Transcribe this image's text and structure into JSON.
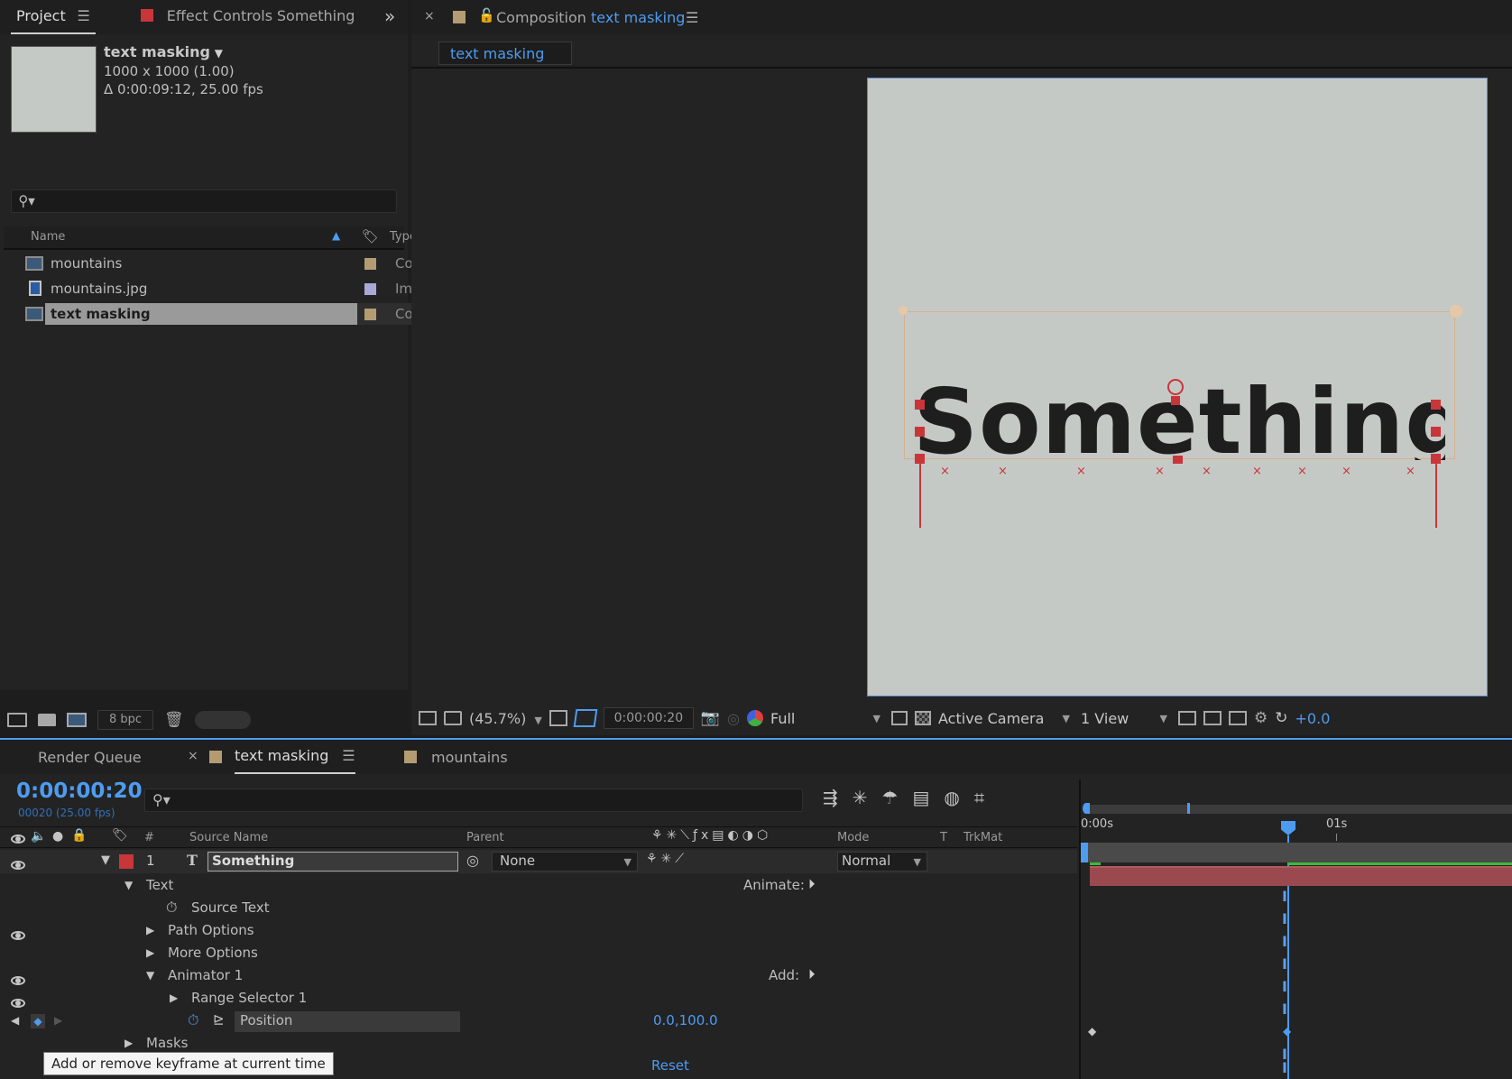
{
  "project_panel": {
    "tab_project": "Project",
    "tab_effect_controls": "Effect Controls",
    "tab_effect_controls_layer": "Something",
    "item_title": "text masking",
    "item_dims": "1000 x 1000 (1.00)",
    "item_duration": "Δ 0:00:09:12, 25.00 fps",
    "search_placeholder": "",
    "col_name": "Name",
    "col_type": "Type",
    "items": [
      {
        "name": "mountains",
        "type": "Co",
        "color": "#b49c72"
      },
      {
        "name": "mountains.jpg",
        "type": "Im",
        "color": "#a9a9d8"
      },
      {
        "name": "text masking",
        "type": "Co",
        "color": "#b49c72"
      }
    ],
    "bpc": "8 bpc"
  },
  "composition_panel": {
    "tab_label": "Composition",
    "comp_name": "text masking",
    "breadcrumb": "text masking",
    "canvas_text": "Something",
    "zoom": "(45.7%)",
    "timecode": "0:00:00:20",
    "resolution": "Full",
    "camera": "Active Camera",
    "views": "1 View",
    "exposure": "+0.0"
  },
  "timeline_panel": {
    "tab_render_queue": "Render Queue",
    "tab_text_masking": "text masking",
    "tab_mountains": "mountains",
    "current_time": "0:00:00:20",
    "frame_info": "00020 (25.00 fps)",
    "col_number": "#",
    "col_source_name": "Source Name",
    "col_parent": "Parent",
    "col_mode": "Mode",
    "col_t": "T",
    "col_trkmat": "TrkMat",
    "ruler_start": "0:00s",
    "ruler_1s": "01s",
    "layer": {
      "number": "1",
      "type_glyph": "T",
      "name": "Something",
      "parent": "None",
      "mode": "Normal"
    },
    "props": {
      "text": "Text",
      "animate": "Animate:",
      "source_text": "Source Text",
      "path_options": "Path Options",
      "more_options": "More Options",
      "animator1": "Animator 1",
      "add": "Add:",
      "range_selector": "Range Selector 1",
      "position": "Position",
      "position_value": "0.0,100.0",
      "masks": "Masks",
      "reset": "Reset"
    },
    "tooltip": "Add or remove keyframe at current time"
  },
  "colors": {
    "accent_blue": "#4d9cf0",
    "label_red": "#c8363a",
    "layer_bar": "#9a4a4e",
    "canvas_bg": "#c5c9c5"
  }
}
